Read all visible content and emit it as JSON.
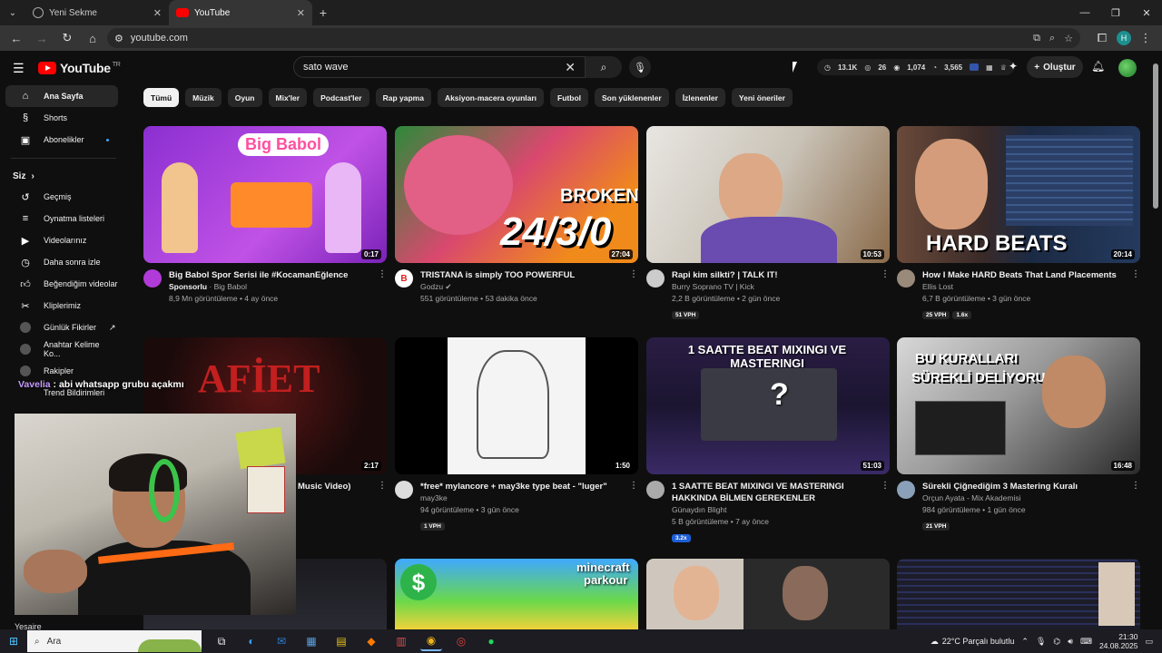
{
  "browser": {
    "tabs": [
      {
        "title": "Yeni Sekme"
      },
      {
        "title": "YouTube"
      }
    ],
    "url": "youtube.com",
    "profile_initial": "H"
  },
  "yt": {
    "logo_text": "YouTube",
    "logo_sup": "TR",
    "search_value": "sato wave",
    "stats": [
      "13.1K",
      "26",
      "1,074",
      "3,565"
    ],
    "create_label": "Oluştur"
  },
  "sidebar": {
    "main": [
      {
        "label": "Ana Sayfa",
        "icon": "home-icon"
      },
      {
        "label": "Shorts",
        "icon": "shorts-icon"
      },
      {
        "label": "Abonelikler",
        "icon": "subscriptions-icon"
      }
    ],
    "you_heading": "Siz",
    "you": [
      {
        "label": "Geçmiş",
        "icon": "history-icon"
      },
      {
        "label": "Oynatma listeleri",
        "icon": "playlists-icon"
      },
      {
        "label": "Videolarınız",
        "icon": "your-videos-icon"
      },
      {
        "label": "Daha sonra izle",
        "icon": "watch-later-icon"
      },
      {
        "label": "Beğendiğim videolar",
        "icon": "liked-icon"
      },
      {
        "label": "Kliplerimiz",
        "icon": "clips-icon"
      }
    ],
    "subs": [
      {
        "label": "Günlük Fikirler"
      },
      {
        "label": "Anahtar Kelime Ko..."
      },
      {
        "label": "Rakipler"
      },
      {
        "label": "Trend Bildirimleri"
      }
    ],
    "bottom_label": "Yesaire"
  },
  "chips": [
    "Tümü",
    "Müzik",
    "Oyun",
    "Mix'ler",
    "Podcast'ler",
    "Rap yapma",
    "Aksiyon-macera oyunları",
    "Futbol",
    "Son yüklenenler",
    "İzlenenler",
    "Yeni öneriler"
  ],
  "videos": [
    {
      "title": "Big Babol Spor Serisi ile #KocamanEğlence",
      "line2_bold": "Sponsorlu",
      "line2": " · Big Babol",
      "line3": "8,9 Mn görüntüleme • 4 ay önce",
      "duration": "0:17",
      "badges": []
    },
    {
      "title": "TRISTANA is simply TOO POWERFUL",
      "line2_bold": "",
      "line2": "Godzu ✔",
      "line3": "551 görüntüleme • 53 dakika önce",
      "duration": "27:04",
      "badges": []
    },
    {
      "title": "Rapi kim silkti? | TALK IT!",
      "line2_bold": "",
      "line2": "Burry Soprano TV | Kick",
      "line3": "2,2 B görüntüleme • 2 gün önce",
      "duration": "10:53",
      "badges": [
        "51 VPH"
      ]
    },
    {
      "title": "How I Make HARD Beats That Land Placements",
      "line2_bold": "",
      "line2": "Ellis Lost",
      "line3": "6,7 B görüntüleme • 3 gün önce",
      "duration": "20:14",
      "badges": [
        "25 VPH",
        "1.6x"
      ]
    },
    {
      "title": "Music Video)",
      "line2_bold": "",
      "line2": "",
      "line3": "",
      "duration": "2:17",
      "badges": []
    },
    {
      "title": "*free* mylancore + may3ke type beat - \"luger\"",
      "line2_bold": "",
      "line2": "may3ke",
      "line3": "94 görüntüleme • 3 gün önce",
      "duration": "1:50",
      "badges": [
        "1 VPH"
      ]
    },
    {
      "title": "1 SAATTE BEAT MIXINGI VE MASTERINGI HAKKINDA BİLMEN GEREKENLER",
      "line2_bold": "",
      "line2": "Günaydın Blight",
      "line3": "5 B görüntüleme • 7 ay önce",
      "duration": "51:03",
      "badges": [
        "3.2x"
      ]
    },
    {
      "title": "Sürekli Çiğnediğim 3 Mastering Kuralı",
      "line2_bold": "",
      "line2": "Orçun Ayata - Mix Akademisi",
      "line3": "984 görüntüleme • 1 gün önce",
      "duration": "16:48",
      "badges": [
        "21 VPH"
      ]
    }
  ],
  "thumb_text": {
    "t1": "Big Babol",
    "t2a": "BROKEN",
    "t2b": "24/3/0",
    "t4": "HARD BEATS",
    "t5": "AFİET",
    "t7": "1 SAATTE BEAT MIXINGI VE MASTERINGI",
    "t8a": "BU KURALLARI",
    "t8b": "SÜREKLİ DELİYORUM!",
    "t10a": "minecraft",
    "t10b": "parkour",
    "t10c": "$"
  },
  "chat": {
    "user": "Vavelia",
    "message": " : abi whatsapp grubu açakmı"
  },
  "taskbar": {
    "search_placeholder": "Ara",
    "weather": "22°C  Parçalı bulutlu",
    "time": "21:30",
    "date": "24.08.2025"
  }
}
